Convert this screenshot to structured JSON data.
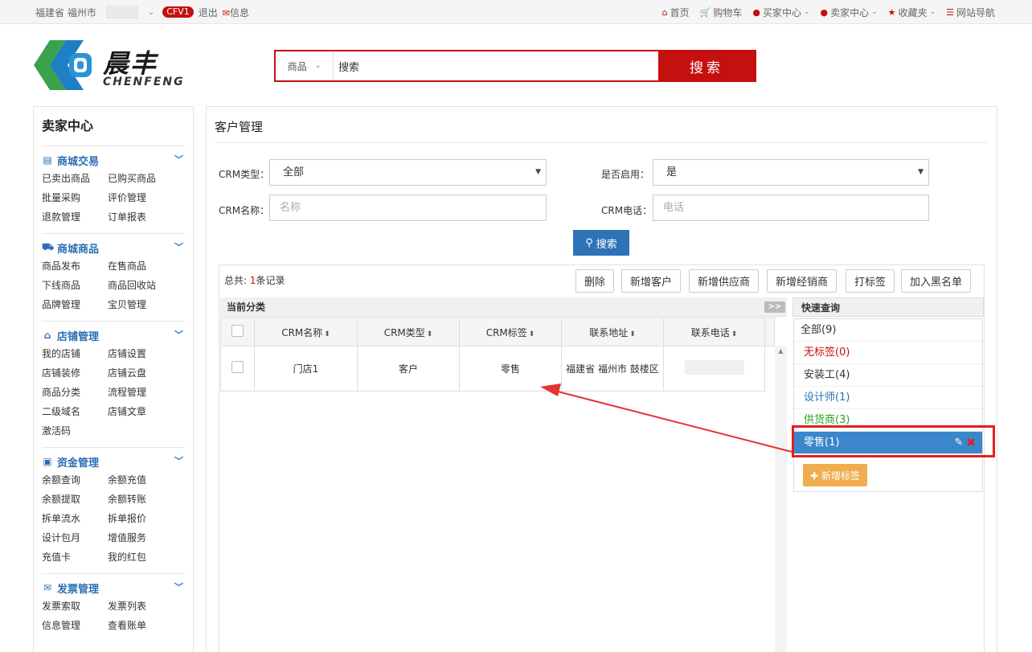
{
  "topbar": {
    "location": "福建省 福州市",
    "badge": "CFV1",
    "logout": "退出",
    "message": "信息",
    "links": [
      "首页",
      "购物车",
      "买家中心",
      "卖家中心",
      "收藏夹",
      "网站导航"
    ]
  },
  "logo": {
    "cn": "晨丰",
    "en": "CHENFENG"
  },
  "search": {
    "category": "商品",
    "value": "搜索",
    "button": "搜索"
  },
  "sidebar": {
    "title": "卖家中心",
    "groups": [
      {
        "title": "商城交易",
        "items": [
          "已卖出商品",
          "已购买商品",
          "批量采购",
          "评价管理",
          "退款管理",
          "订单报表"
        ]
      },
      {
        "title": "商城商品",
        "items": [
          "商品发布",
          "在售商品",
          "下线商品",
          "商品回收站",
          "品牌管理",
          "宝贝管理"
        ]
      },
      {
        "title": "店铺管理",
        "items": [
          "我的店铺",
          "店铺设置",
          "店铺装修",
          "店铺云盘",
          "商品分类",
          "流程管理",
          "二级域名",
          "店铺文章",
          "激活码"
        ]
      },
      {
        "title": "资金管理",
        "items": [
          "余额查询",
          "余额充值",
          "余额提取",
          "余额转账",
          "拆单流水",
          "拆单报价",
          "设计包月",
          "增值服务",
          "充值卡",
          "我的红包"
        ]
      },
      {
        "title": "发票管理",
        "items": [
          "发票索取",
          "发票列表",
          "信息管理",
          "查看账单"
        ]
      }
    ]
  },
  "main": {
    "title": "客户管理",
    "filters": {
      "crm_type_label": "CRM类型：",
      "crm_type_value": "全部",
      "enabled_label": "是否启用：",
      "enabled_value": "是",
      "crm_name_label": "CRM名称：",
      "crm_name_placeholder": "名称",
      "crm_phone_label": "CRM电话：",
      "crm_phone_placeholder": "电话",
      "search_button": "搜索"
    },
    "total_prefix": "总共: ",
    "total_count": "1",
    "total_suffix": "条记录",
    "actions": [
      "删除",
      "新增客户",
      "新增供应商",
      "新增经销商",
      "打标签",
      "加入黑名单"
    ],
    "current_category": "当前分类",
    "expand": ">>",
    "columns": [
      "CRM名称",
      "CRM类型",
      "CRM标签",
      "联系地址",
      "联系电话"
    ],
    "rows": [
      {
        "name": "门店1",
        "type": "客户",
        "tag": "零售",
        "address": "福建省 福州市 鼓楼区",
        "phone": ""
      }
    ]
  },
  "quick": {
    "title": "快速查询",
    "all": "全部(9)",
    "tags": [
      {
        "label": "无标签(0)",
        "color": "#c51010"
      },
      {
        "label": "安装工(4)",
        "color": "#333333"
      },
      {
        "label": "设计师(1)",
        "color": "#2a6fb4"
      },
      {
        "label": "供货商(3)",
        "color": "#28a028"
      }
    ],
    "selected": "零售(1)",
    "add_tag": "新增标签"
  }
}
